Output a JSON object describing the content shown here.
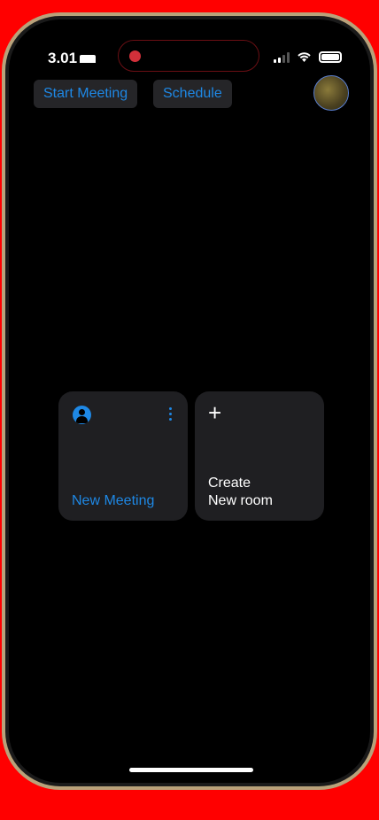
{
  "status_bar": {
    "time": "3.01"
  },
  "header": {
    "start_meeting": "Start Meeting",
    "schedule": "Schedule"
  },
  "cards": {
    "new_meeting": "New Meeting",
    "create_line1": "Create",
    "create_line2": "New room"
  },
  "colors": {
    "accent": "#1e88e5",
    "card": "#1f1f22",
    "recording": "#d2303a"
  }
}
